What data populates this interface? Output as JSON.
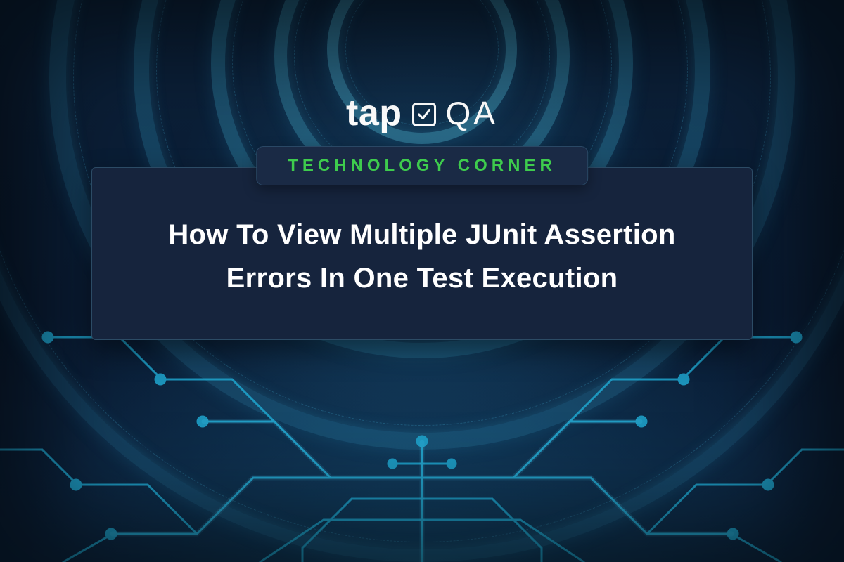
{
  "brand": {
    "word1": "tap",
    "word2": "QA"
  },
  "badge": {
    "label": "TECHNOLOGY CORNER"
  },
  "card": {
    "title": "How To View Multiple JUnit Assertion Errors In One Test Execution"
  },
  "colors": {
    "accent_green": "#3ecb4d",
    "panel": "#16243d",
    "badge_bg": "#1a2a45"
  }
}
